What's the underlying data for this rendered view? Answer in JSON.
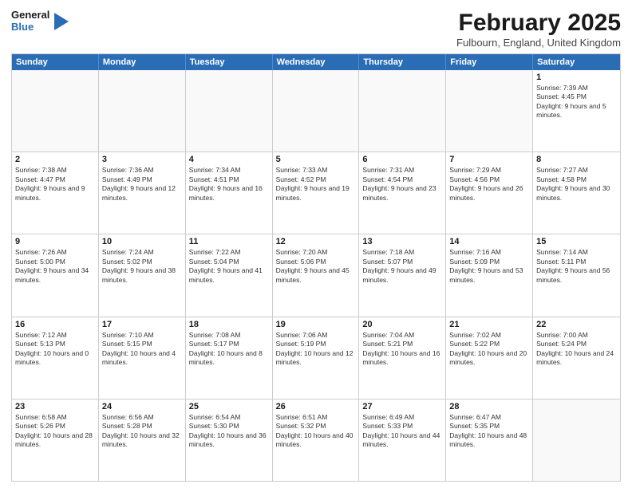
{
  "header": {
    "logo_line1": "General",
    "logo_line2": "Blue",
    "main_title": "February 2025",
    "subtitle": "Fulbourn, England, United Kingdom"
  },
  "days_of_week": [
    "Sunday",
    "Monday",
    "Tuesday",
    "Wednesday",
    "Thursday",
    "Friday",
    "Saturday"
  ],
  "weeks": [
    [
      {
        "day": "",
        "text": "",
        "empty": true
      },
      {
        "day": "",
        "text": "",
        "empty": true
      },
      {
        "day": "",
        "text": "",
        "empty": true
      },
      {
        "day": "",
        "text": "",
        "empty": true
      },
      {
        "day": "",
        "text": "",
        "empty": true
      },
      {
        "day": "",
        "text": "",
        "empty": true
      },
      {
        "day": "1",
        "text": "Sunrise: 7:39 AM\nSunset: 4:45 PM\nDaylight: 9 hours and 5 minutes."
      }
    ],
    [
      {
        "day": "2",
        "text": "Sunrise: 7:38 AM\nSunset: 4:47 PM\nDaylight: 9 hours and 9 minutes."
      },
      {
        "day": "3",
        "text": "Sunrise: 7:36 AM\nSunset: 4:49 PM\nDaylight: 9 hours and 12 minutes."
      },
      {
        "day": "4",
        "text": "Sunrise: 7:34 AM\nSunset: 4:51 PM\nDaylight: 9 hours and 16 minutes."
      },
      {
        "day": "5",
        "text": "Sunrise: 7:33 AM\nSunset: 4:52 PM\nDaylight: 9 hours and 19 minutes."
      },
      {
        "day": "6",
        "text": "Sunrise: 7:31 AM\nSunset: 4:54 PM\nDaylight: 9 hours and 23 minutes."
      },
      {
        "day": "7",
        "text": "Sunrise: 7:29 AM\nSunset: 4:56 PM\nDaylight: 9 hours and 26 minutes."
      },
      {
        "day": "8",
        "text": "Sunrise: 7:27 AM\nSunset: 4:58 PM\nDaylight: 9 hours and 30 minutes."
      }
    ],
    [
      {
        "day": "9",
        "text": "Sunrise: 7:26 AM\nSunset: 5:00 PM\nDaylight: 9 hours and 34 minutes."
      },
      {
        "day": "10",
        "text": "Sunrise: 7:24 AM\nSunset: 5:02 PM\nDaylight: 9 hours and 38 minutes."
      },
      {
        "day": "11",
        "text": "Sunrise: 7:22 AM\nSunset: 5:04 PM\nDaylight: 9 hours and 41 minutes."
      },
      {
        "day": "12",
        "text": "Sunrise: 7:20 AM\nSunset: 5:06 PM\nDaylight: 9 hours and 45 minutes."
      },
      {
        "day": "13",
        "text": "Sunrise: 7:18 AM\nSunset: 5:07 PM\nDaylight: 9 hours and 49 minutes."
      },
      {
        "day": "14",
        "text": "Sunrise: 7:16 AM\nSunset: 5:09 PM\nDaylight: 9 hours and 53 minutes."
      },
      {
        "day": "15",
        "text": "Sunrise: 7:14 AM\nSunset: 5:11 PM\nDaylight: 9 hours and 56 minutes."
      }
    ],
    [
      {
        "day": "16",
        "text": "Sunrise: 7:12 AM\nSunset: 5:13 PM\nDaylight: 10 hours and 0 minutes."
      },
      {
        "day": "17",
        "text": "Sunrise: 7:10 AM\nSunset: 5:15 PM\nDaylight: 10 hours and 4 minutes."
      },
      {
        "day": "18",
        "text": "Sunrise: 7:08 AM\nSunset: 5:17 PM\nDaylight: 10 hours and 8 minutes."
      },
      {
        "day": "19",
        "text": "Sunrise: 7:06 AM\nSunset: 5:19 PM\nDaylight: 10 hours and 12 minutes."
      },
      {
        "day": "20",
        "text": "Sunrise: 7:04 AM\nSunset: 5:21 PM\nDaylight: 10 hours and 16 minutes."
      },
      {
        "day": "21",
        "text": "Sunrise: 7:02 AM\nSunset: 5:22 PM\nDaylight: 10 hours and 20 minutes."
      },
      {
        "day": "22",
        "text": "Sunrise: 7:00 AM\nSunset: 5:24 PM\nDaylight: 10 hours and 24 minutes."
      }
    ],
    [
      {
        "day": "23",
        "text": "Sunrise: 6:58 AM\nSunset: 5:26 PM\nDaylight: 10 hours and 28 minutes."
      },
      {
        "day": "24",
        "text": "Sunrise: 6:56 AM\nSunset: 5:28 PM\nDaylight: 10 hours and 32 minutes."
      },
      {
        "day": "25",
        "text": "Sunrise: 6:54 AM\nSunset: 5:30 PM\nDaylight: 10 hours and 36 minutes."
      },
      {
        "day": "26",
        "text": "Sunrise: 6:51 AM\nSunset: 5:32 PM\nDaylight: 10 hours and 40 minutes."
      },
      {
        "day": "27",
        "text": "Sunrise: 6:49 AM\nSunset: 5:33 PM\nDaylight: 10 hours and 44 minutes."
      },
      {
        "day": "28",
        "text": "Sunrise: 6:47 AM\nSunset: 5:35 PM\nDaylight: 10 hours and 48 minutes."
      },
      {
        "day": "",
        "text": "",
        "empty": true
      }
    ]
  ]
}
